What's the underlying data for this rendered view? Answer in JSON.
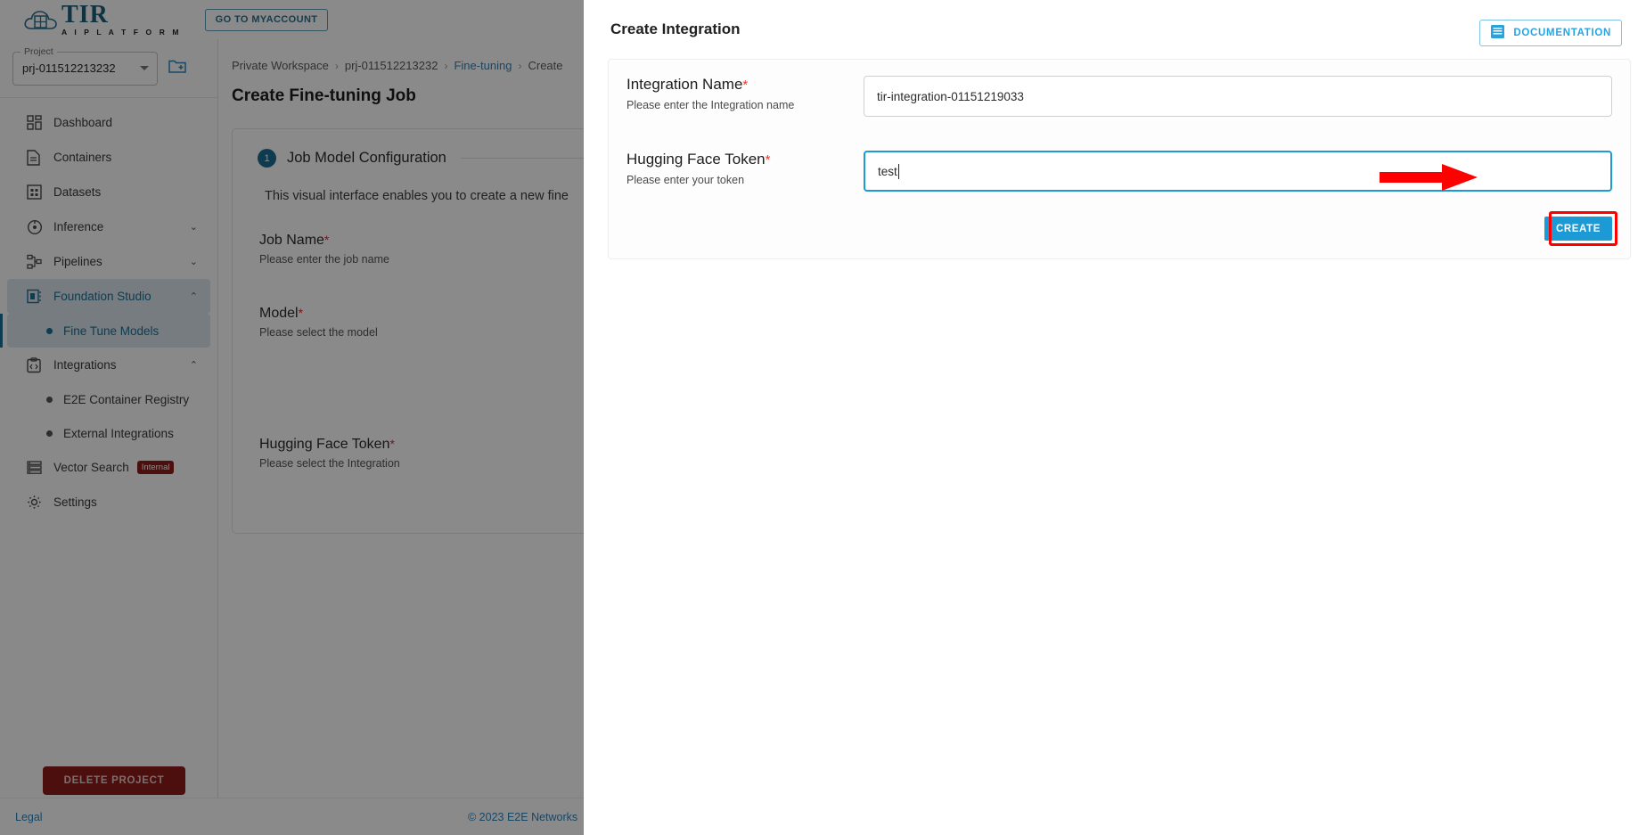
{
  "topbar": {
    "logo_title": "TIR",
    "logo_subtitle": "A I  P L A T F O R M",
    "myaccount_label": "GO TO MYACCOUNT",
    "logo_icon": "cloud-grid-icon"
  },
  "sidebar": {
    "project_legend": "Project",
    "project_value": "prj-011512213232",
    "new_project_icon": "new-folder-icon",
    "dropdown_icon": "chevron-down-icon",
    "items": [
      {
        "label": "Dashboard",
        "icon": "dashboard-icon",
        "expandable": false,
        "active": false
      },
      {
        "label": "Containers",
        "icon": "document-icon",
        "expandable": false,
        "active": false
      },
      {
        "label": "Datasets",
        "icon": "grid-table-icon",
        "expandable": false,
        "active": false
      },
      {
        "label": "Inference",
        "icon": "inference-icon",
        "expandable": true,
        "chevron": "⌄",
        "active": false
      },
      {
        "label": "Pipelines",
        "icon": "pipelines-icon",
        "expandable": true,
        "chevron": "⌄",
        "active": false
      },
      {
        "label": "Foundation Studio",
        "icon": "foundation-studio-icon",
        "expandable": true,
        "chevron": "⌃",
        "active": true
      }
    ],
    "foundation_children": [
      {
        "label": "Fine Tune Models",
        "selected": true
      }
    ],
    "integrations": {
      "label": "Integrations",
      "icon": "code-clipboard-icon",
      "chevron": "⌃"
    },
    "integrations_children": [
      {
        "label": "E2E Container Registry",
        "selected": false
      },
      {
        "label": "External Integrations",
        "selected": false
      }
    ],
    "vector_search": {
      "label": "Vector Search",
      "icon": "list-rows-icon",
      "badge": "Internal"
    },
    "settings": {
      "label": "Settings",
      "icon": "gear-icon"
    },
    "delete_project_label": "DELETE PROJECT"
  },
  "main": {
    "breadcrumb": [
      {
        "text": "Private Workspace",
        "link": false
      },
      {
        "text": "prj-011512213232",
        "link": false
      },
      {
        "text": "Fine-tuning",
        "link": true
      },
      {
        "text": "Create",
        "link": false
      }
    ],
    "breadcrumb_separator": "›",
    "page_title": "Create Fine-tuning Job",
    "card": {
      "step_number": "1",
      "heading": "Job Model Configuration",
      "description": "This visual interface enables you to create a new fine",
      "fields": [
        {
          "label": "Job Name",
          "required": "*",
          "sub": "Please enter the job name"
        },
        {
          "label": "Model",
          "required": "*",
          "sub": "Please select the model"
        },
        {
          "label": "Hugging Face Token",
          "required": "*",
          "sub": "Please select the Integration"
        }
      ]
    }
  },
  "footer": {
    "legal": "Legal",
    "copyright": "© 2023 E2E Networks"
  },
  "drawer": {
    "title": "Create Integration",
    "documentation_label": "DOCUMENTATION",
    "documentation_icon": "book-icon",
    "fields": [
      {
        "label": "Integration Name",
        "required": "*",
        "sub": "Please enter the Integration name",
        "value": "tir-integration-01151219033",
        "focused": false
      },
      {
        "label": "Hugging Face Token",
        "required": "*",
        "sub": "Please enter your token",
        "value": "test",
        "focused": true
      }
    ],
    "create_label": "CREATE",
    "annotation": {
      "arrow_icon": "red-arrow-right",
      "highlight_color": "#ff0000"
    }
  },
  "colors": {
    "accent_blue": "#1b9ad6",
    "link_blue": "#2e86c1",
    "nav_active_bg": "#dbe6ec",
    "nav_active_text": "#1a6f96",
    "danger_red": "#8f1a1a",
    "annotation_red": "#ff0000"
  }
}
